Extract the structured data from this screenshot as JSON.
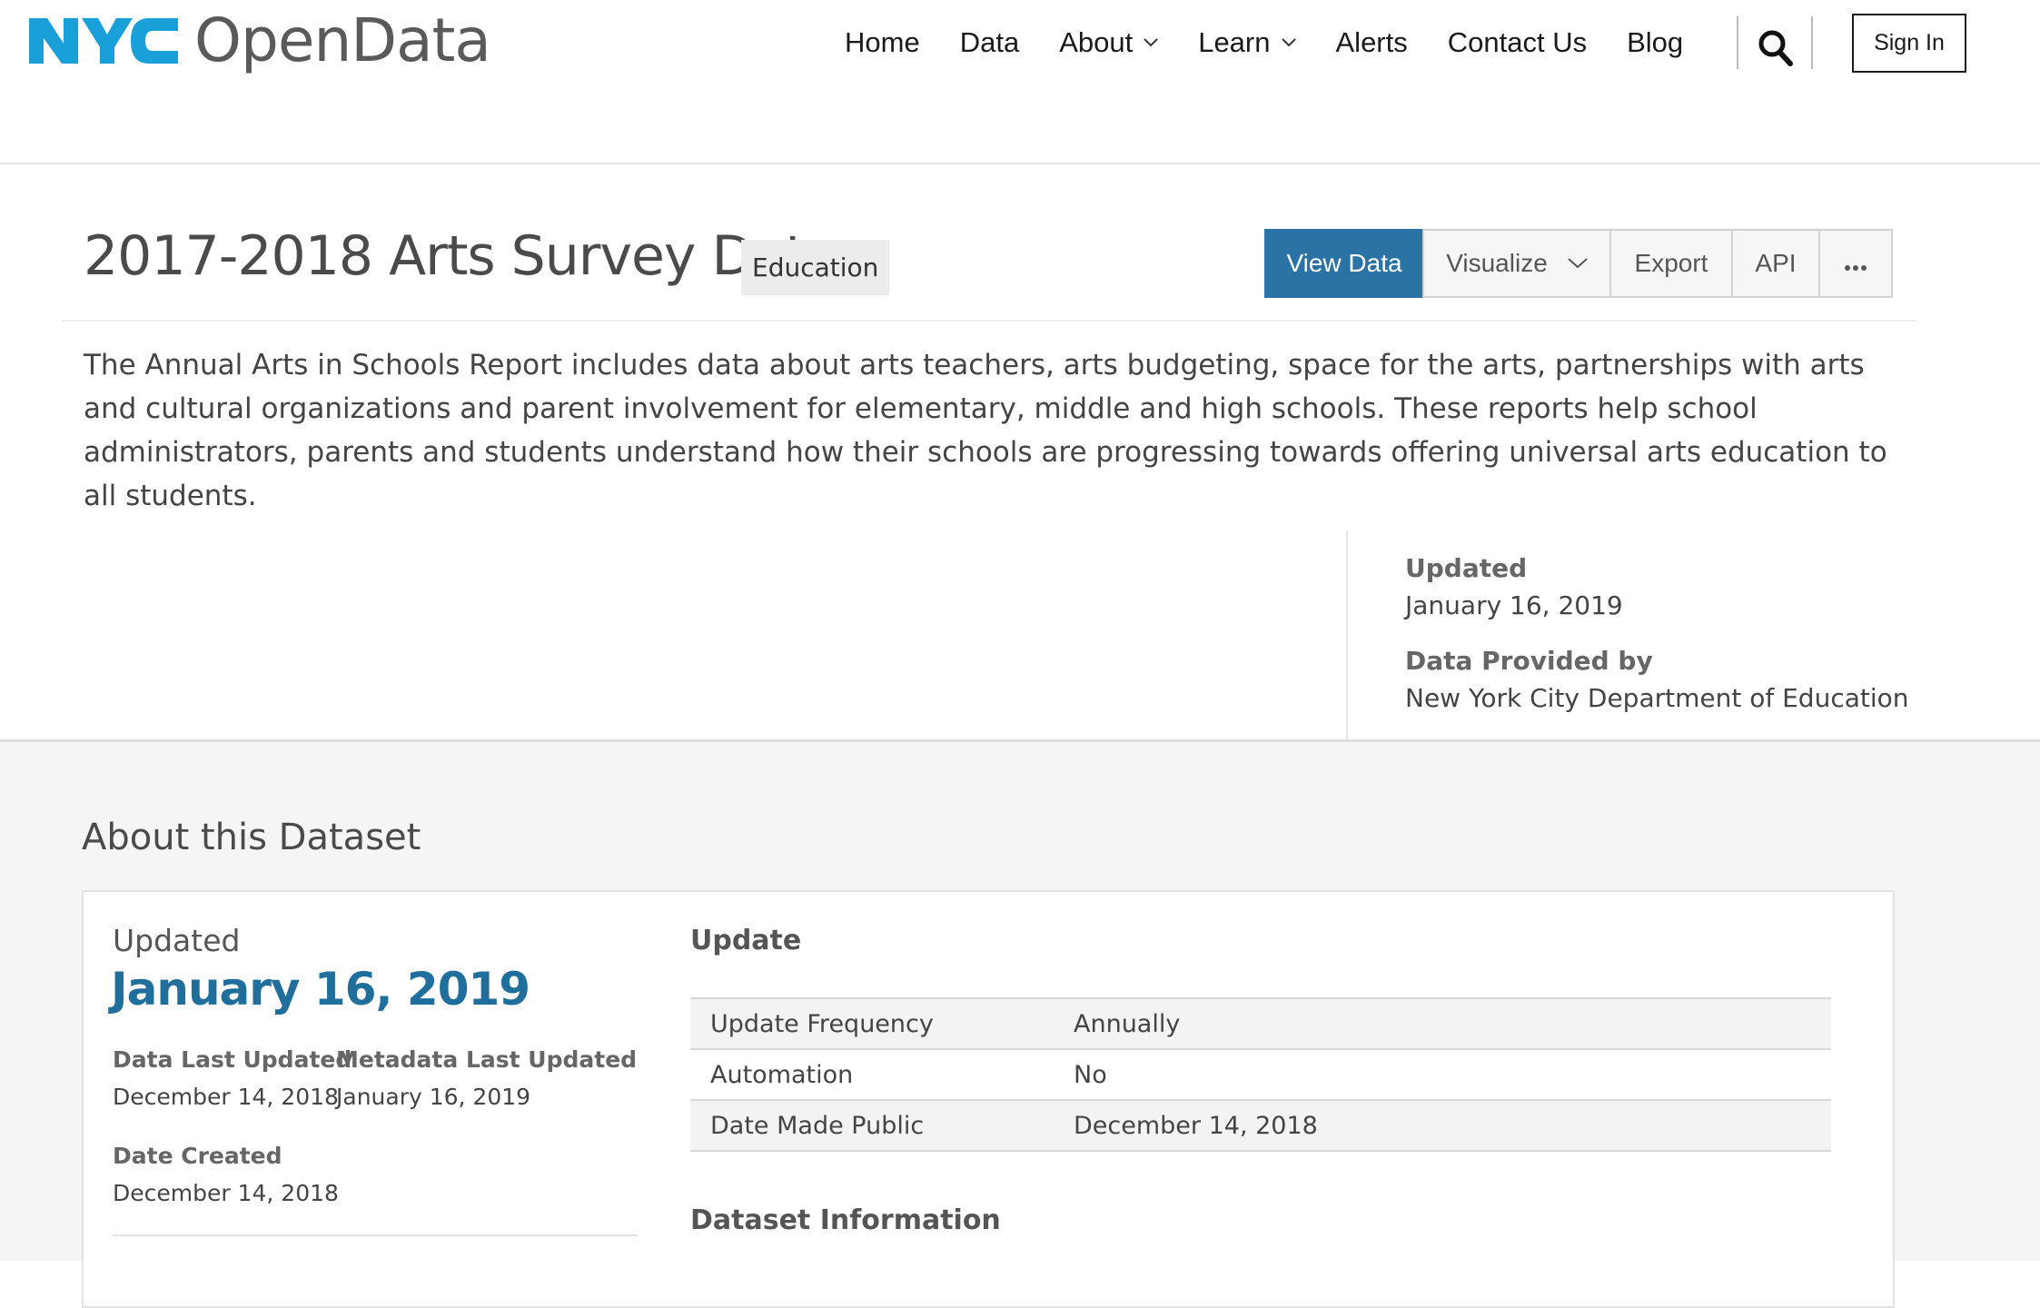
{
  "header": {
    "logo_text": "OpenData",
    "logo_mark_text": "NYC",
    "brand_color": "#1aa0d8",
    "nav": [
      {
        "label": "Home",
        "dropdown": false
      },
      {
        "label": "Data",
        "dropdown": false
      },
      {
        "label": "About",
        "dropdown": true
      },
      {
        "label": "Learn",
        "dropdown": true
      },
      {
        "label": "Alerts",
        "dropdown": false
      },
      {
        "label": "Contact Us",
        "dropdown": false
      },
      {
        "label": "Blog",
        "dropdown": false
      }
    ],
    "search_icon": "search-icon",
    "sign_in_label": "Sign In"
  },
  "dataset": {
    "title": "2017-2018 Arts Survey Data",
    "category": "Education",
    "actions": {
      "view_data": "View Data",
      "visualize": "Visualize",
      "export": "Export",
      "api": "API",
      "more": "···"
    },
    "accent_color": "#2b73a4",
    "description": "The Annual Arts in Schools Report includes data about arts teachers, arts budgeting, space for the arts, partnerships with arts and cultural organizations and parent involvement for elementary, middle and high schools. These reports help school administrators, parents and students understand how their schools are progressing towards offering universal arts education to all students.",
    "sidebar": {
      "updated_label": "Updated",
      "updated_value": "January 16, 2019",
      "provided_label": "Data Provided by",
      "provided_value": "New York City Department of Education"
    }
  },
  "about": {
    "heading": "About this Dataset",
    "updated_label": "Updated",
    "updated_date": "January 16, 2019",
    "data_last_updated_label": "Data Last Updated",
    "data_last_updated_value": "December 14, 2018",
    "metadata_last_updated_label": "Metadata Last Updated",
    "metadata_last_updated_value": "January 16, 2019",
    "date_created_label": "Date Created",
    "date_created_value": "December 14, 2018",
    "update_heading": "Update",
    "update_rows": [
      {
        "key": "Update Frequency",
        "value": "Annually"
      },
      {
        "key": "Automation",
        "value": "No"
      },
      {
        "key": "Date Made Public",
        "value": "December 14, 2018"
      }
    ],
    "dataset_info_heading": "Dataset Information"
  }
}
